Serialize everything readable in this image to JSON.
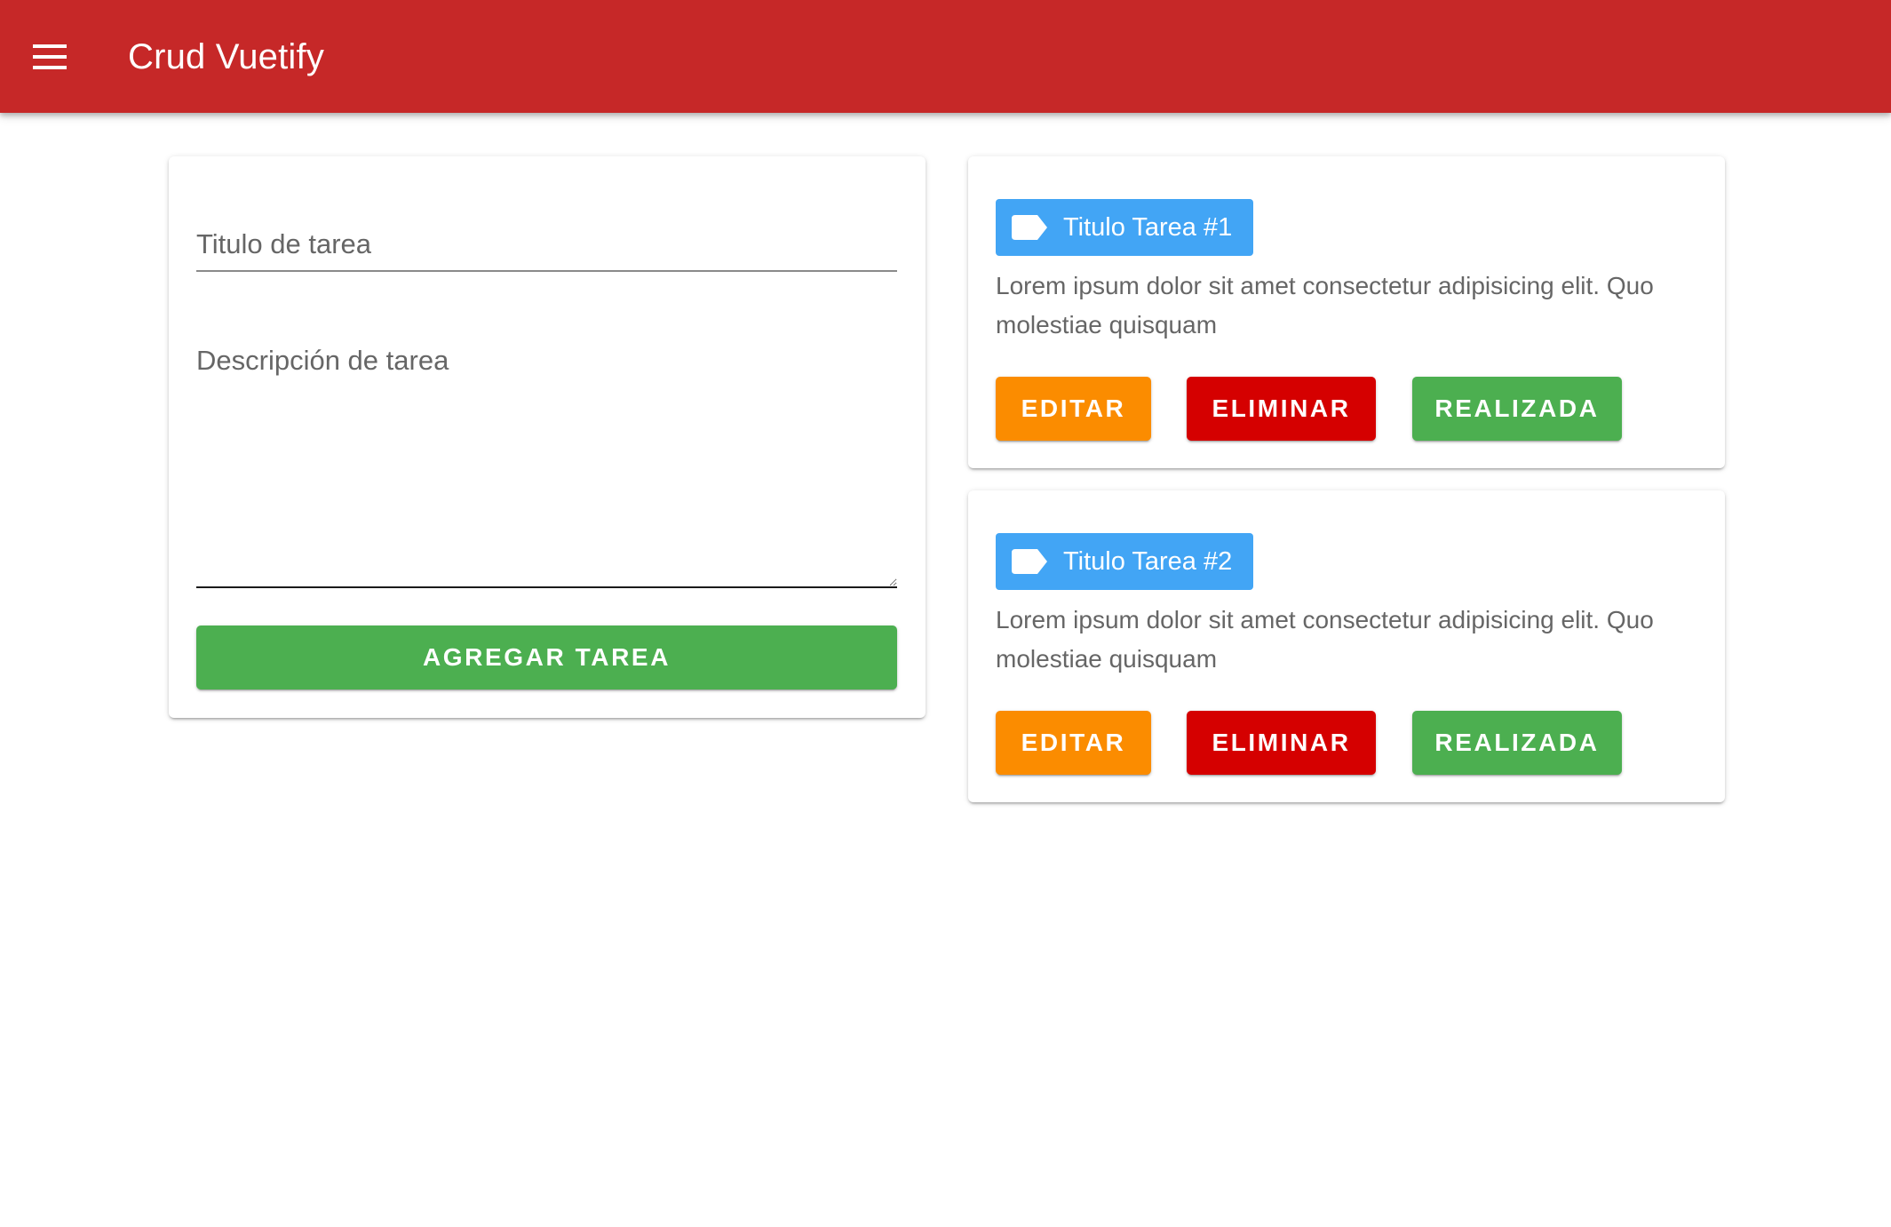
{
  "app_bar": {
    "title": "Crud Vuetify",
    "color": "#c62828",
    "nav_icon": "menu-icon"
  },
  "form": {
    "title_placeholder": "Titulo de tarea",
    "description_placeholder": "Descripción de tarea",
    "add_button_label": "AGREGAR TAREA"
  },
  "tasks": [
    {
      "title": "Titulo Tarea #1",
      "icon": "label-icon",
      "description": "Lorem ipsum dolor sit amet consectetur adipisicing elit. Quo molestiae quisquam",
      "edit_label": "EDITAR",
      "delete_label": "ELIMINAR",
      "done_label": "REALIZADA"
    },
    {
      "title": "Titulo Tarea #2",
      "icon": "label-icon",
      "description": "Lorem ipsum dolor sit amet consectetur adipisicing elit. Quo molestiae quisquam",
      "edit_label": "EDITAR",
      "delete_label": "ELIMINAR",
      "done_label": "REALIZADA"
    }
  ],
  "colors": {
    "primary_bar": "#c62828",
    "add_button": "#4caf50",
    "edit_button": "#fb8c00",
    "delete_button": "#d50000",
    "done_button": "#4caf50",
    "chip": "#42a5f5"
  }
}
